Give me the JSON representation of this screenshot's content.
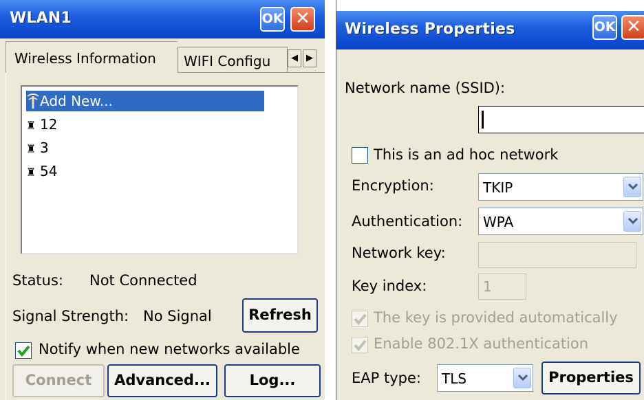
{
  "wlan": {
    "title": "WLAN1",
    "ok_label": "OK",
    "close_label": "✕",
    "tabs": [
      "Wireless Information",
      "WIFI Configu"
    ],
    "networks": [
      "Add New...",
      "12",
      "3",
      "54"
    ],
    "status_label": "Status:",
    "status_value": "Not Connected",
    "signal_label": "Signal Strength:",
    "signal_value": "No Signal",
    "refresh_label": "Refresh",
    "notify_label": "Notify when new networks available",
    "connect_label": "Connect",
    "advanced_label": "Advanced...",
    "log_label": "Log..."
  },
  "wireless_props": {
    "title": "Wireless Properties",
    "ok_label": "OK",
    "close_label": "✕",
    "ssid_label": "Network name (SSID):",
    "ssid_value": "",
    "adhoc_label": "This is an ad hoc network",
    "encryption_label": "Encryption:",
    "encryption_value": "TKIP",
    "authentication_label": "Authentication:",
    "authentication_value": "WPA",
    "network_key_label": "Network key:",
    "network_key_value": "",
    "key_index_label": "Key index:",
    "key_index_value": "1",
    "key_auto_label": "The key is provided automatically",
    "enable_8021x_label": "Enable 802.1X authentication",
    "eap_type_label": "EAP type:",
    "eap_type_value": "TLS",
    "properties_label": "Properties"
  },
  "colors": {
    "titlebar": "#1d5fdf",
    "window_bg": "#ece9d8",
    "selection": "#316ac5",
    "checkmark": "#21a121"
  }
}
